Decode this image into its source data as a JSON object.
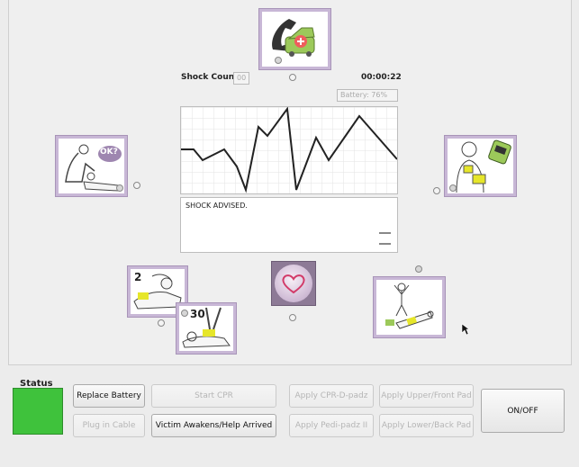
{
  "header": {
    "shock_count_label": "Shock Count:",
    "shock_count_value": "00",
    "timer": "00:00:22",
    "battery": "Battery: 76%"
  },
  "monitor": {
    "message": "SHOCK ADVISED."
  },
  "steps": [
    {
      "icon": "call-ambulance-icon"
    },
    {
      "icon": "check-responsiveness-icon",
      "bubble": "OK?"
    },
    {
      "icon": "open-aed-icon"
    },
    {
      "icon": "rescue-breaths-icon",
      "count": "2"
    },
    {
      "icon": "chest-compressions-icon",
      "count": "30"
    },
    {
      "icon": "attach-pads-icon"
    }
  ],
  "status": {
    "title": "Status",
    "color": "#3fc23c"
  },
  "buttons": {
    "replace_battery": "Replace Battery",
    "plug_in_cable": "Plug in Cable",
    "start_cpr": "Start CPR",
    "victim_awakens": "Victim Awakens/Help Arrived",
    "apply_cpr_d": "Apply CPR-D-padz",
    "apply_pedi": "Apply Pedi-padz II",
    "apply_upper": "Apply Upper/Front Pad",
    "apply_lower": "Apply Lower/Back Pad",
    "on_off": "ON/OFF"
  },
  "colors": {
    "accent_purple": "#c8b7d6",
    "pad_yellow": "#e6e62a",
    "ambulance_green": "#9cc95a",
    "heart_button": "#8d7a96"
  }
}
